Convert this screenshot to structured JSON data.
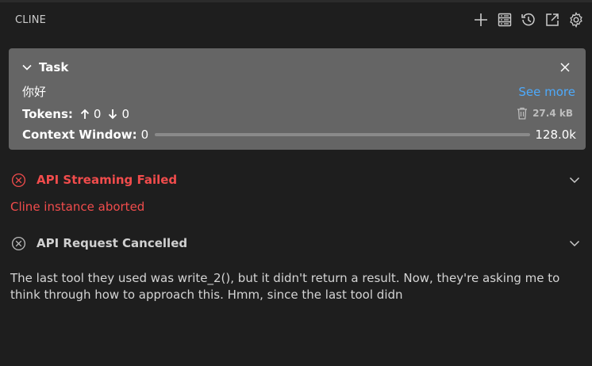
{
  "header": {
    "title": "CLINE",
    "actions": [
      "plus-icon",
      "history-list-icon",
      "history-icon",
      "popout-icon",
      "settings-icon"
    ]
  },
  "task": {
    "label": "Task",
    "text": "你好",
    "see_more": "See more",
    "tokens_label": "Tokens:",
    "tokens_in": "0",
    "tokens_out": "0",
    "size": "27.4 kB",
    "context_label": "Context Window:",
    "context_used": "0",
    "context_max": "128.0k",
    "context_fraction": 0.0
  },
  "messages": {
    "error_title": "API Streaming Failed",
    "error_detail": "Cline instance aborted",
    "cancel_title": "API Request Cancelled",
    "body": "The last tool they used was write_2(), but it didn't return a result. Now, they're asking me to think through how to approach this. Hmm, since the last tool didn"
  },
  "colors": {
    "background": "#1e1e1e",
    "card": "#656565",
    "error": "#f14c4c",
    "link": "#4daafc"
  }
}
